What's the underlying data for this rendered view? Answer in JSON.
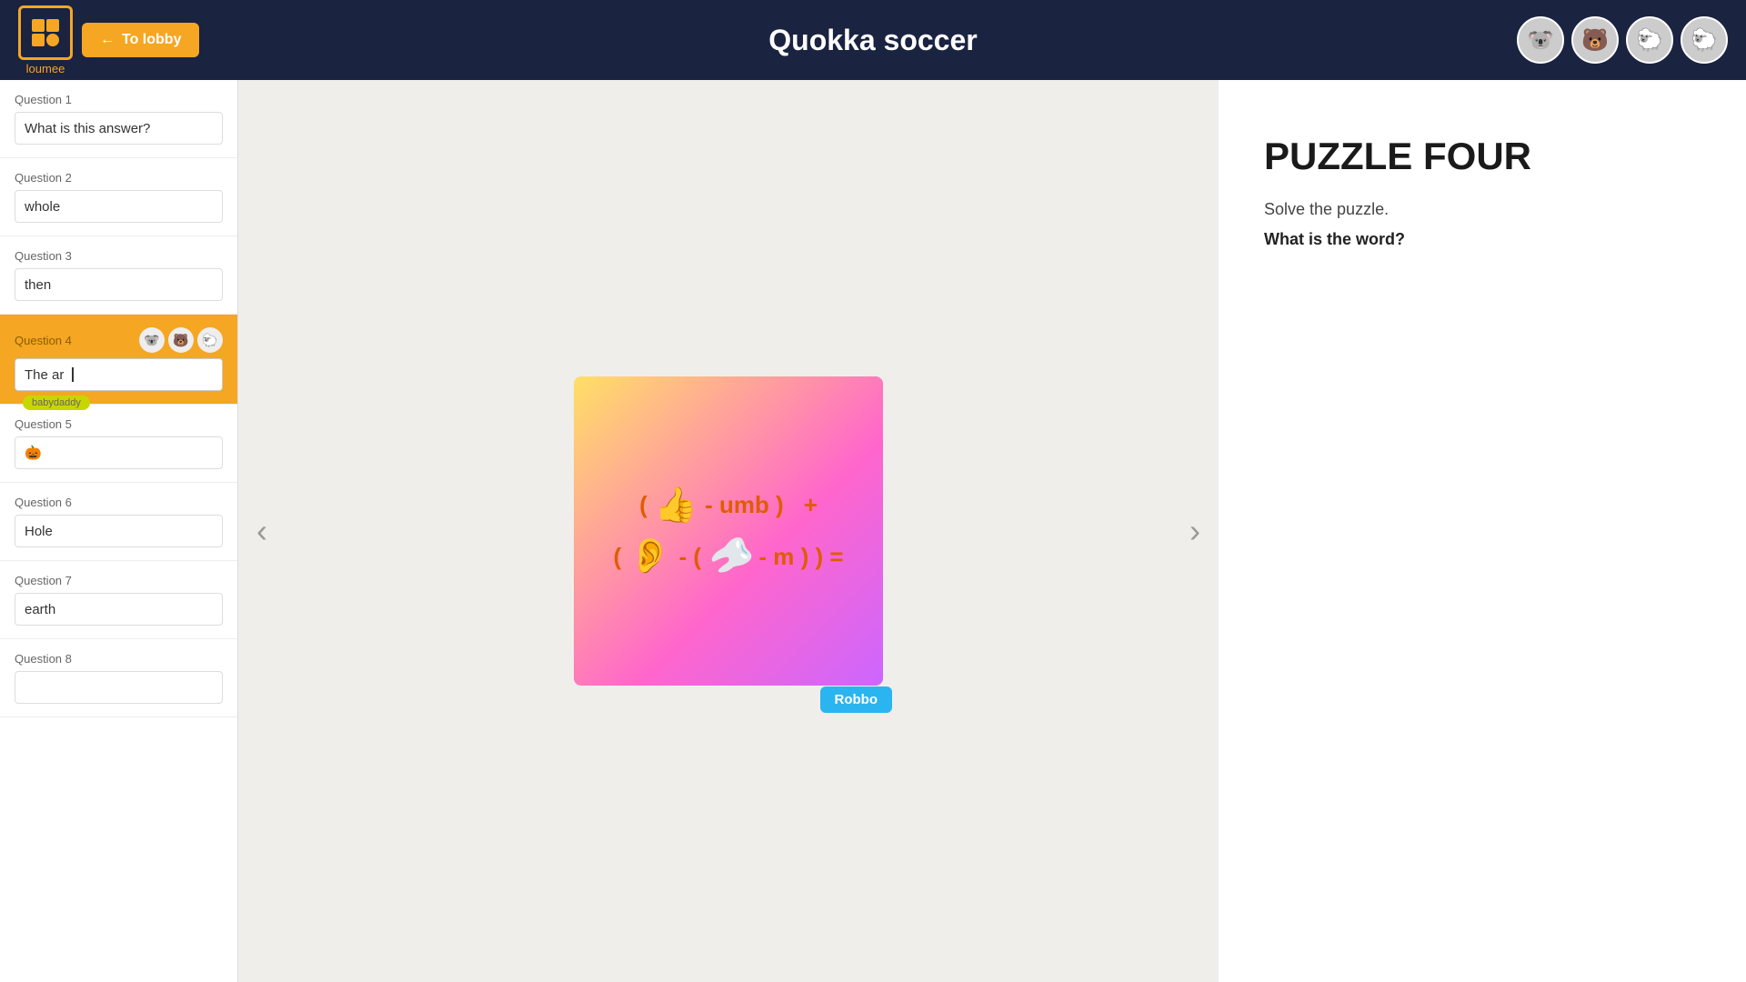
{
  "header": {
    "title": "Quokka soccer",
    "to_lobby": "To lobby",
    "logo_symbol": "lo",
    "logo_brand": "loumee"
  },
  "avatars": [
    "🐨",
    "🐻",
    "🐑",
    "🐑"
  ],
  "sidebar": {
    "questions": [
      {
        "id": 1,
        "label": "Question 1",
        "answer": "What is this answer?",
        "active": false,
        "has_avatar": false,
        "emoji": ""
      },
      {
        "id": 2,
        "label": "Question 2",
        "answer": "whole",
        "active": false,
        "has_avatar": false,
        "emoji": ""
      },
      {
        "id": 3,
        "label": "Question 3",
        "answer": "then",
        "active": false,
        "has_avatar": false,
        "emoji": ""
      },
      {
        "id": 4,
        "label": "Question 4",
        "answer": "The ar",
        "active": true,
        "has_avatar": true,
        "emoji": "",
        "tooltip": "babydaddy"
      },
      {
        "id": 5,
        "label": "Question 5",
        "answer": "",
        "active": false,
        "has_avatar": false,
        "emoji": "🎃"
      },
      {
        "id": 6,
        "label": "Question 6",
        "answer": "Hole",
        "active": false,
        "has_avatar": false,
        "emoji": ""
      },
      {
        "id": 7,
        "label": "Question 7",
        "answer": "earth",
        "active": false,
        "has_avatar": false,
        "emoji": ""
      },
      {
        "id": 8,
        "label": "Question 8",
        "answer": "",
        "active": false,
        "has_avatar": false,
        "emoji": ""
      }
    ]
  },
  "puzzle": {
    "section_label": "PUZZLE FOUR",
    "description": "Solve the puzzle.",
    "question": "What is the word?",
    "nav_left": "‹",
    "nav_right": "›",
    "robbo_label": "Robbo",
    "eq_line1_open": "(",
    "eq_line1_thumb": "👍",
    "eq_line1_minus_umb": "- umb )",
    "eq_line1_plus": "+",
    "eq_line2_open": "(",
    "eq_line2_ear": "👂",
    "eq_line2_minus": "-",
    "eq_line2_boomerang": "🪃",
    "eq_line2_minus_m": "- m ) )",
    "eq_line2_eq": "="
  }
}
